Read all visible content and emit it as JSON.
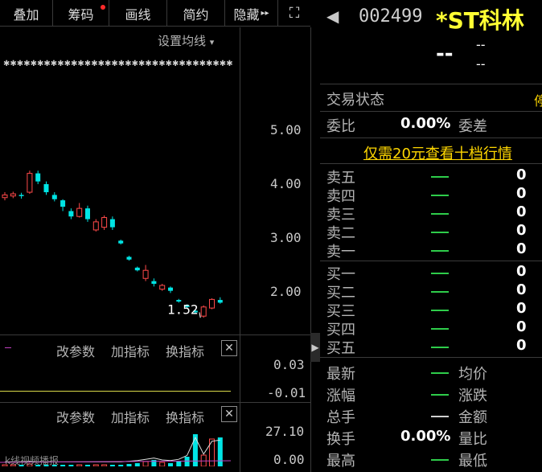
{
  "toolbar": {
    "buttons": [
      "叠加",
      "筹码",
      "画线",
      "简约",
      "隐藏"
    ],
    "more_glyph": "▸▸",
    "fullscreen_glyph": "⛶"
  },
  "chart": {
    "settings_label": "设置均线",
    "settings_arrow": "▾",
    "y_ticks": [
      "5.00",
      "4.00",
      "3.00",
      "2.00"
    ],
    "low_label": "1.52",
    "indicator_panel_1": {
      "buttons": [
        "改参数",
        "加指标",
        "换指标"
      ],
      "y_ticks": [
        "0.03",
        "-0.01"
      ]
    },
    "indicator_panel_2": {
      "buttons": [
        "改参数",
        "加指标",
        "换指标"
      ],
      "y_ticks": [
        "27.10",
        "0.00"
      ]
    },
    "close_glyph": "✕",
    "watermark": "k线视频播报"
  },
  "chart_data": {
    "type": "candlestick",
    "ylim": [
      1.3,
      5.2
    ],
    "candles": [
      {
        "o": 3.75,
        "c": 3.8,
        "h": 3.85,
        "l": 3.7
      },
      {
        "o": 3.78,
        "c": 3.82,
        "h": 3.86,
        "l": 3.74
      },
      {
        "o": 3.8,
        "c": 3.78,
        "h": 3.84,
        "l": 3.73
      },
      {
        "o": 3.85,
        "c": 4.2,
        "h": 4.25,
        "l": 3.82
      },
      {
        "o": 4.2,
        "c": 4.05,
        "h": 4.25,
        "l": 4.0
      },
      {
        "o": 4.0,
        "c": 3.85,
        "h": 4.05,
        "l": 3.8
      },
      {
        "o": 3.8,
        "c": 3.72,
        "h": 3.85,
        "l": 3.68
      },
      {
        "o": 3.7,
        "c": 3.58,
        "h": 3.72,
        "l": 3.5
      },
      {
        "o": 3.5,
        "c": 3.4,
        "h": 3.55,
        "l": 3.35
      },
      {
        "o": 3.4,
        "c": 3.55,
        "h": 3.65,
        "l": 3.38
      },
      {
        "o": 3.55,
        "c": 3.35,
        "h": 3.6,
        "l": 3.3
      },
      {
        "o": 3.15,
        "c": 3.3,
        "h": 3.35,
        "l": 3.12
      },
      {
        "o": 3.2,
        "c": 3.38,
        "h": 3.42,
        "l": 3.15
      },
      {
        "o": 3.35,
        "c": 3.2,
        "h": 3.4,
        "l": 3.15
      },
      {
        "o": 2.95,
        "c": 2.9,
        "h": 2.97,
        "l": 2.88
      },
      {
        "o": 2.65,
        "c": 2.6,
        "h": 2.67,
        "l": 2.58
      },
      {
        "o": 2.45,
        "c": 2.4,
        "h": 2.47,
        "l": 2.38
      },
      {
        "o": 2.25,
        "c": 2.4,
        "h": 2.5,
        "l": 2.2
      },
      {
        "o": 2.2,
        "c": 2.15,
        "h": 2.25,
        "l": 2.1
      },
      {
        "o": 2.05,
        "c": 2.12,
        "h": 2.15,
        "l": 2.02
      },
      {
        "o": 2.08,
        "c": 2.02,
        "h": 2.1,
        "l": 1.98
      },
      {
        "o": 1.85,
        "c": 1.82,
        "h": 1.87,
        "l": 1.8
      },
      {
        "o": 1.75,
        "c": 1.72,
        "h": 1.77,
        "l": 1.7
      },
      {
        "o": 1.65,
        "c": 1.62,
        "h": 1.67,
        "l": 1.6
      },
      {
        "o": 1.55,
        "c": 1.72,
        "h": 1.75,
        "l": 1.52
      },
      {
        "o": 1.7,
        "c": 1.86,
        "h": 1.88,
        "l": 1.68
      },
      {
        "o": 1.85,
        "c": 1.8,
        "h": 1.9,
        "l": 1.78
      }
    ]
  },
  "quote": {
    "back_glyph": "◀",
    "code": "002499",
    "name": "*ST科林",
    "price": "--",
    "change": "--",
    "change_pct": "--",
    "trade_status_label": "交易状态",
    "trade_status_value": "停",
    "weibi_label": "委比",
    "weibi_value": "0.00%",
    "weicha_label": "委差",
    "promo": "仅需20元查看十档行情",
    "asks": [
      {
        "label": "卖五",
        "qty": "0"
      },
      {
        "label": "卖四",
        "qty": "0"
      },
      {
        "label": "卖三",
        "qty": "0"
      },
      {
        "label": "卖二",
        "qty": "0"
      },
      {
        "label": "卖一",
        "qty": "0"
      }
    ],
    "bids": [
      {
        "label": "买一",
        "qty": "0"
      },
      {
        "label": "买二",
        "qty": "0"
      },
      {
        "label": "买三",
        "qty": "0"
      },
      {
        "label": "买四",
        "qty": "0"
      },
      {
        "label": "买五",
        "qty": "0"
      }
    ],
    "stats": {
      "latest": "最新",
      "avg": "均价",
      "change_pct": "涨幅",
      "change": "涨跌",
      "volume": "总手",
      "amount": "金额",
      "turnover": "换手",
      "turnover_value": "0.00%",
      "vol_ratio": "量比",
      "high": "最高",
      "low": "最低"
    }
  },
  "colors": {
    "up": "#ff4a4a",
    "down": "#00e5e5",
    "accent": "#ffff33",
    "green": "#2ecc4a"
  }
}
